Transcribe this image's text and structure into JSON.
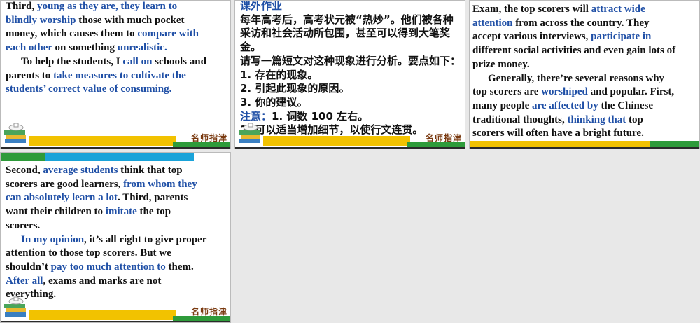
{
  "slide1": {
    "lines": [
      [
        {
          "t": "Third, ",
          "b": false
        },
        {
          "t": "young as they are, they learn to",
          "b": true
        }
      ],
      [
        {
          "t": "blindly worship",
          "b": true
        },
        {
          "t": " those with much pocket",
          "b": false
        }
      ],
      [
        {
          "t": "money, which causes them to ",
          "b": false
        },
        {
          "t": "compare with",
          "b": true
        }
      ],
      [
        {
          "t": "each other",
          "b": true
        },
        {
          "t": " on something ",
          "b": false
        },
        {
          "t": "unrealistic.",
          "b": true
        }
      ],
      [
        {
          "t": "To help the students, I ",
          "b": false
        },
        {
          "t": "call on",
          "b": true
        },
        {
          "t": " schools and",
          "b": false
        }
      ],
      [
        {
          "t": "parents to ",
          "b": false
        },
        {
          "t": "take measures to cultivate the",
          "b": true
        }
      ],
      [
        {
          "t": "students’ correct value of consuming.",
          "b": true
        }
      ]
    ]
  },
  "slide2": {
    "title": "课外作业",
    "lines": [
      "每年高考后，高考状元被“热炒”。他们被各种",
      "采访和社会活动所包围，甚至可以得到大笔奖金。",
      "请写一篇短文对这种现象进行分析。要点如下：",
      "1. 存在的现象。",
      "2. 引起此现象的原因。",
      "3. 你的建议。"
    ],
    "note_label": "注意：",
    "note_lines": [
      "1. 词数 100 左右。",
      "2. 可以适当增加细节，以使行文连贯。"
    ]
  },
  "slide3": {
    "lines": [
      [
        {
          "t": "Exam, the top scorers will ",
          "b": false
        },
        {
          "t": "attract wide",
          "b": true
        }
      ],
      [
        {
          "t": "attention",
          "b": true
        },
        {
          "t": " from across the country. They",
          "b": false
        }
      ],
      [
        {
          "t": "accept various interviews, ",
          "b": false
        },
        {
          "t": "participate in",
          "b": true
        }
      ],
      [
        {
          "t": "different social activities and even gain lots of",
          "b": false
        }
      ],
      [
        {
          "t": "prize money.",
          "b": false
        }
      ],
      [
        {
          "t": "Generally, there’re several reasons why",
          "b": false
        }
      ],
      [
        {
          "t": "top scorers are ",
          "b": false
        },
        {
          "t": "worshiped",
          "b": true
        },
        {
          "t": " and popular. First,",
          "b": false
        }
      ],
      [
        {
          "t": "many people ",
          "b": false
        },
        {
          "t": "are affected by",
          "b": true
        },
        {
          "t": " the Chinese",
          "b": false
        }
      ],
      [
        {
          "t": "traditional thoughts, ",
          "b": false
        },
        {
          "t": "thinking that",
          "b": true
        },
        {
          "t": " top",
          "b": false
        }
      ],
      [
        {
          "t": "scorers will often have a bright future.",
          "b": false
        }
      ]
    ]
  },
  "slide4": {
    "lines": [
      [
        {
          "t": "Second, ",
          "b": false
        },
        {
          "t": "average students",
          "b": true
        },
        {
          "t": " think that top",
          "b": false
        }
      ],
      [
        {
          "t": "scorers are good learners, ",
          "b": false
        },
        {
          "t": "from whom they",
          "b": true
        }
      ],
      [
        {
          "t": "can absolutely learn a lot",
          "b": true
        },
        {
          "t": ". Third, parents",
          "b": false
        }
      ],
      [
        {
          "t": "want their children to ",
          "b": false
        },
        {
          "t": "imitate",
          "b": true
        },
        {
          "t": " the top",
          "b": false
        }
      ],
      [
        {
          "t": "scorers.",
          "b": false
        }
      ],
      [
        {
          "t": "In my opinion",
          "b": true
        },
        {
          "t": ", it’s all right to give proper",
          "b": false
        }
      ],
      [
        {
          "t": "attention to those top scorers. But we",
          "b": false
        }
      ],
      [
        {
          "t": "shouldn’t ",
          "b": false
        },
        {
          "t": "pay too much attention to",
          "b": true
        },
        {
          "t": " them.",
          "b": false
        }
      ],
      [
        {
          "t": "After all",
          "b": true
        },
        {
          "t": ", exams and marks are not",
          "b": false
        }
      ],
      [
        {
          "t": "everything.",
          "b": false
        }
      ]
    ]
  },
  "footer": {
    "brand": "名师指津"
  },
  "colors": {
    "accent_blue": "#1f4fa6",
    "yellow": "#f2c200",
    "green": "#2e9b3a",
    "cyan": "#1aa3d9"
  }
}
